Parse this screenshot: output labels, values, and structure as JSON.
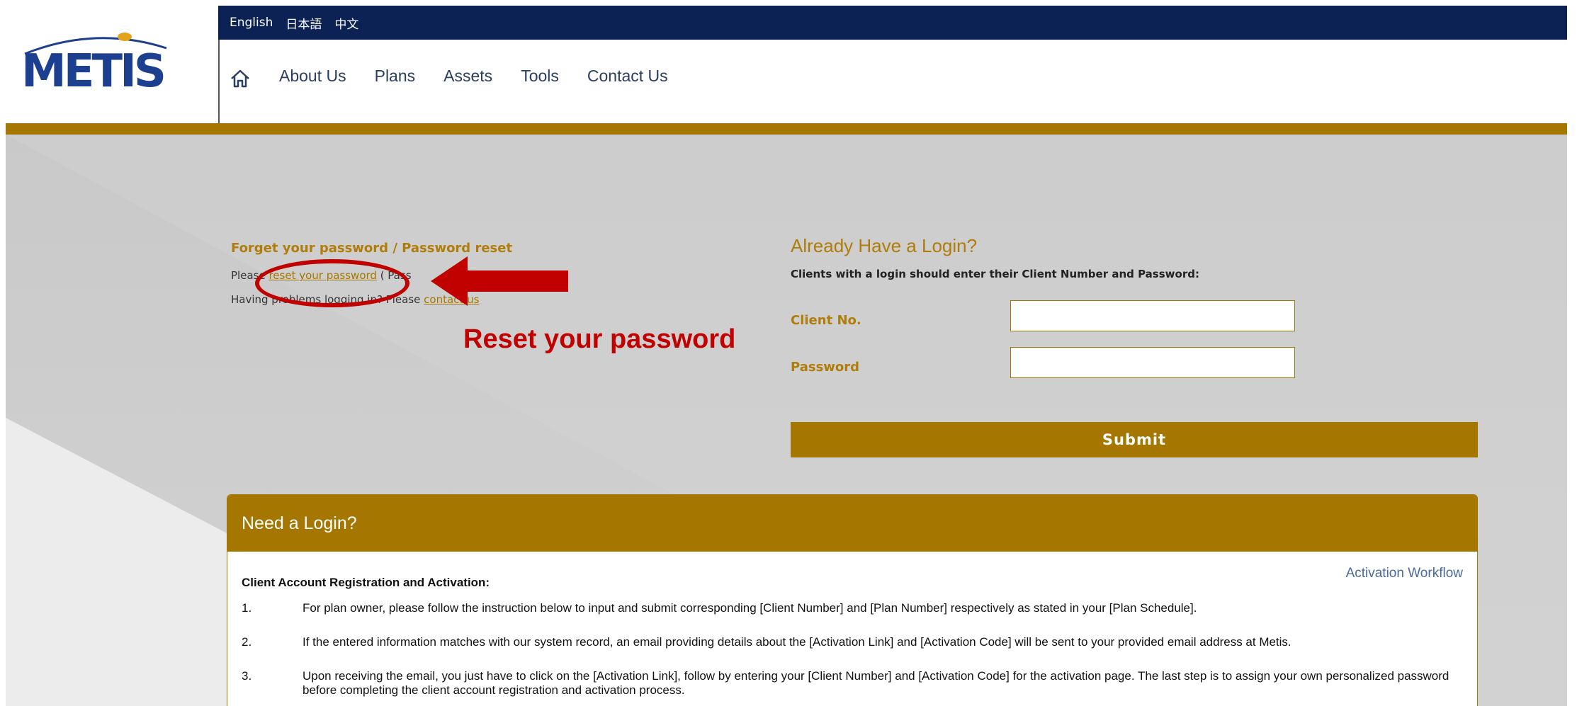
{
  "logo": {
    "text": "METIS"
  },
  "languages": [
    "English",
    "日本語",
    "中文"
  ],
  "nav": {
    "home_icon": "home-icon",
    "items": [
      "About Us",
      "Plans",
      "Assets",
      "Tools",
      "Contact Us"
    ]
  },
  "forgot": {
    "title": "Forget your password / Password reset",
    "line1_prefix": "Please ",
    "line1_link": "reset your password",
    "line1_suffix": " ( Pass",
    "line2_prefix": "Having problems logging in? Please ",
    "line2_link": "contact us"
  },
  "annotation": {
    "text": "Reset your password",
    "color": "#c10000"
  },
  "login": {
    "title": "Already Have a Login?",
    "subtitle": "Clients with a login should enter their Client Number and Password:",
    "client_label": "Client No.",
    "password_label": "Password",
    "client_value": "",
    "password_value": "",
    "submit": "Submit"
  },
  "need_login": {
    "title": "Need a Login?",
    "workflow_link": "Activation Workflow",
    "reg_title": "Client Account Registration and Activation:",
    "steps": [
      {
        "num": "1.",
        "text": "For plan owner, please follow the instruction below to input and submit corresponding [Client Number] and [Plan Number] respectively as stated in your [Plan Schedule]."
      },
      {
        "num": "2.",
        "text": "If the entered information matches with our system record, an email providing details about the [Activation Link] and [Activation Code] will be sent to your provided email address at Metis."
      },
      {
        "num": "3.",
        "text": "Upon receiving the email, you just have to click on the [Activation Link], follow by entering your [Client Number] and [Activation Code] for the activation page. The last step is to assign your own personalized password before completing the client account registration and activation process."
      }
    ]
  },
  "colors": {
    "navy": "#0c2255",
    "gold": "#a57600",
    "accent_text": "#b07d0a"
  }
}
